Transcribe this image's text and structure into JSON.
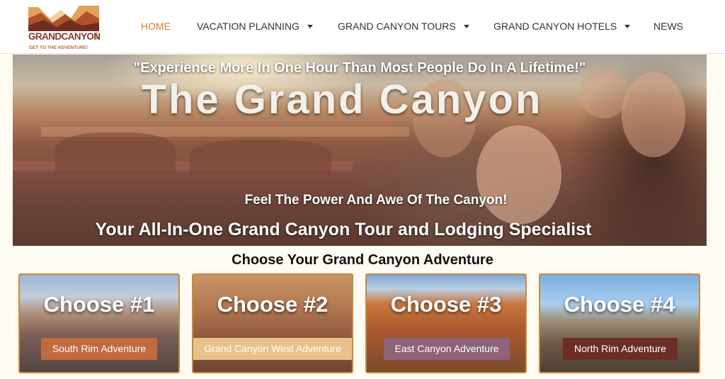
{
  "header": {
    "logo": {
      "name": "GRANDCANYON",
      "suffix": ".com",
      "tagline": "GET TO THE ADVENTURE!"
    },
    "nav": [
      {
        "label": "HOME",
        "active": true,
        "dropdown": false
      },
      {
        "label": "VACATION PLANNING",
        "active": false,
        "dropdown": true
      },
      {
        "label": "GRAND CANYON TOURS",
        "active": false,
        "dropdown": true
      },
      {
        "label": "GRAND CANYON HOTELS",
        "active": false,
        "dropdown": true
      },
      {
        "label": "NEWS",
        "active": false,
        "dropdown": false
      }
    ]
  },
  "hero": {
    "quote": "\"Experience More In One Hour Than Most People Do In A Lifetime!\"",
    "title": "The Grand Canyon",
    "subtitle": "Feel The Power And Awe Of The Canyon!",
    "specialist": "Your All-In-One Grand Canyon Tour and Lodging Specialist"
  },
  "adventures": {
    "heading": "Choose Your Grand Canyon Adventure",
    "cards": [
      {
        "title": "Choose #1",
        "button": "South Rim Adventure"
      },
      {
        "title": "Choose #2",
        "button": "Grand Canyon West Adventure"
      },
      {
        "title": "Choose #3",
        "button": "East Canyon Adventure"
      },
      {
        "title": "Choose #4",
        "button": "North Rim Adventure"
      }
    ]
  },
  "colors": {
    "accent": "#d5822f",
    "card_border": "#c98a3c",
    "south_rim_button": "#c06a3e",
    "west_button": "#e8c28a",
    "east_button": "#8e6278",
    "north_rim_button": "#6d2d27"
  }
}
